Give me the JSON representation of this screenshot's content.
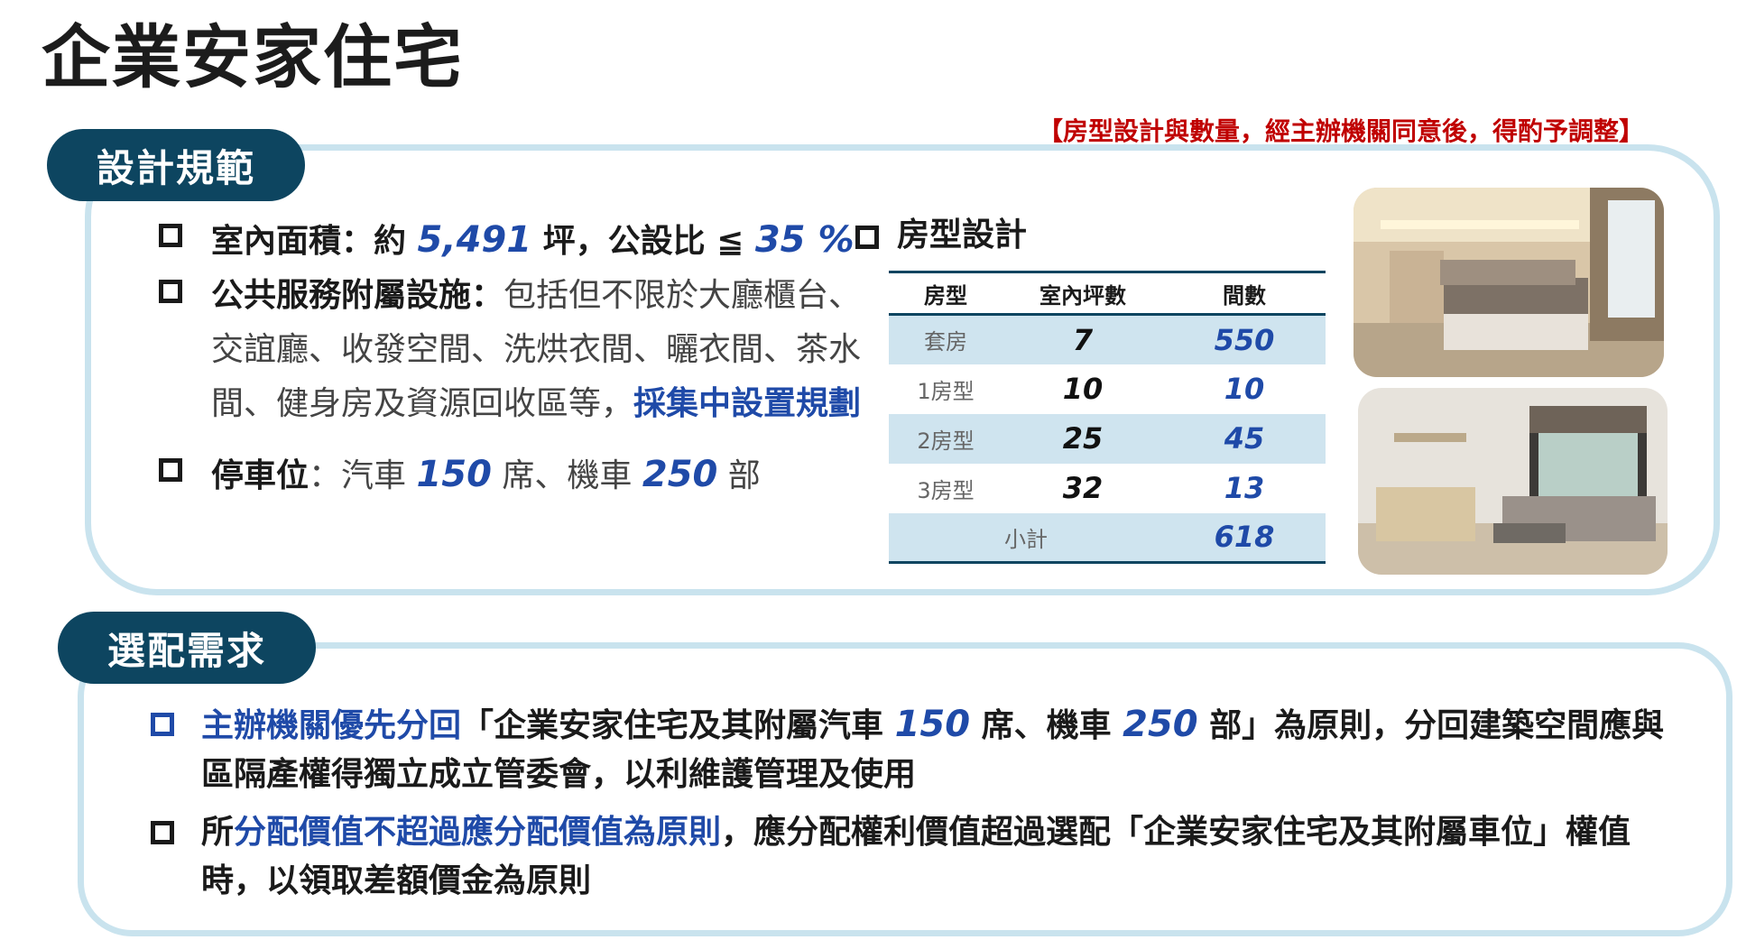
{
  "title": "企業安家住宅",
  "note": "【房型設計與數量，經主辦機關同意後，得酌予調整】",
  "section1": {
    "heading": "設計規範",
    "b1": {
      "k1": "室內面積：約 ",
      "n1": "5,491",
      "k2": " 坪，公設比 ≦ ",
      "n2": "35",
      "k3": " %"
    },
    "b2": {
      "k": "公共服務附屬設施：",
      "t1": "包括但不限於大廳櫃台、",
      "t2": "交誼廳、收發空間、洗烘衣間、曬衣間、茶水",
      "t3": "間、健身房及資源回收區等，",
      "blue": "採集中設置規劃"
    },
    "b3": {
      "k": "停車位",
      "t1": "：汽車 ",
      "n1": "150",
      "t2": " 席、機車 ",
      "n2": "250",
      "t3": " 部"
    },
    "table": {
      "heading": "房型設計",
      "headers": [
        "房型",
        "室內坪數",
        "間數"
      ],
      "rows": [
        {
          "type": "套房",
          "ping": "7",
          "count": "550"
        },
        {
          "type": "1房型",
          "ping": "10",
          "count": "10"
        },
        {
          "type": "2房型",
          "ping": "25",
          "count": "45"
        },
        {
          "type": "3房型",
          "ping": "32",
          "count": "13"
        }
      ],
      "subtotal_label": "小計",
      "subtotal_value": "618"
    }
  },
  "section2": {
    "heading": "選配需求",
    "b4": {
      "blue": "主辦機關優先分回",
      "t1": "「企業安家住宅及其附屬汽車 ",
      "n1": "150",
      "t2": " 席、機車 ",
      "n2": "250",
      "t3": " 部」為原則，分回建築空間應與",
      "line2": "區隔產權得獨立成立管委會，以利維護管理及使用"
    },
    "b5": {
      "t1": "所",
      "blue": "分配價值不超過應分配價值為原則",
      "t2": "，應分配權利價值超過選配「企業安家住宅及其附屬車位」權值",
      "line2": "時，以領取差額價金為原則"
    }
  },
  "colors": {
    "accent": "#0d4560",
    "panel_border": "#c9e3ee",
    "highlight": "#1f4aa8",
    "note": "#c00000",
    "table_shade": "#cfe4ef"
  },
  "icons": [
    "bullet-square-icon"
  ]
}
